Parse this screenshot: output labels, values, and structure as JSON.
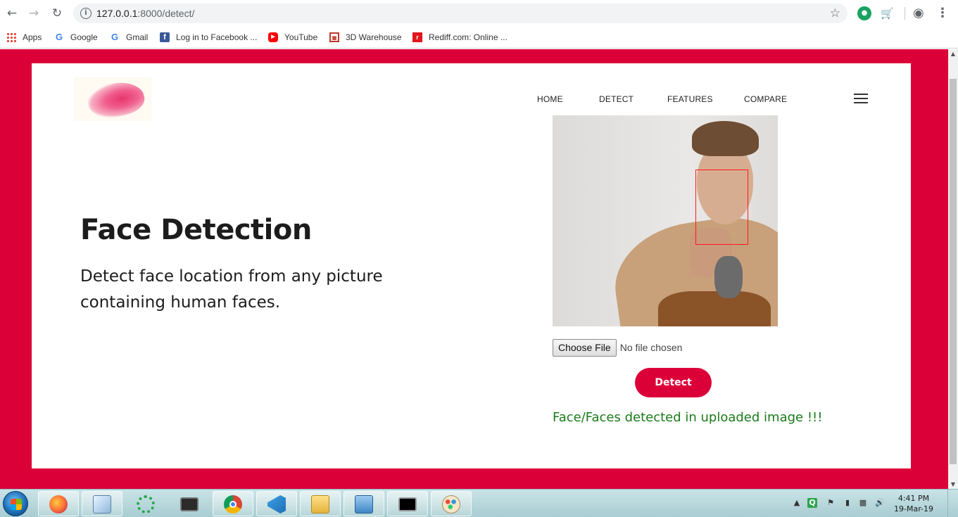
{
  "browser": {
    "url_host": "127.0.0.1",
    "url_rest": ":8000/detect/",
    "bookmarks": [
      {
        "label": "Apps",
        "icon": "apps-grid-icon"
      },
      {
        "label": "Google",
        "icon": "google-icon"
      },
      {
        "label": "Gmail",
        "icon": "google-icon"
      },
      {
        "label": "Log in to Facebook ...",
        "icon": "facebook-icon"
      },
      {
        "label": "YouTube",
        "icon": "youtube-icon"
      },
      {
        "label": "3D Warehouse",
        "icon": "3d-warehouse-icon"
      },
      {
        "label": "Rediff.com: Online ...",
        "icon": "rediff-icon"
      }
    ]
  },
  "page": {
    "nav": [
      "HOME",
      "DETECT",
      "FEATURES",
      "COMPARE"
    ],
    "hero_title": "Face Detection",
    "hero_subtitle": "Detect face location from any picture containing human faces.",
    "file_button": "Choose File",
    "file_status": "No file chosen",
    "detect_button": "Detect",
    "result_message": "Face/Faces detected in uploaded image !!!",
    "colors": {
      "accent": "#dc0039",
      "success_text": "#1b7a1b",
      "detection_box": "#ff1a1a"
    }
  },
  "taskbar": {
    "apps": [
      "firefox-icon",
      "notepad-icon",
      "loading-ring-icon",
      "terminal-icon",
      "chrome-icon",
      "vscode-icon",
      "file-explorer-icon",
      "control-panel-icon",
      "cmd-icon",
      "paint-icon"
    ],
    "time": "4:41 PM",
    "date": "19-Mar-19"
  }
}
